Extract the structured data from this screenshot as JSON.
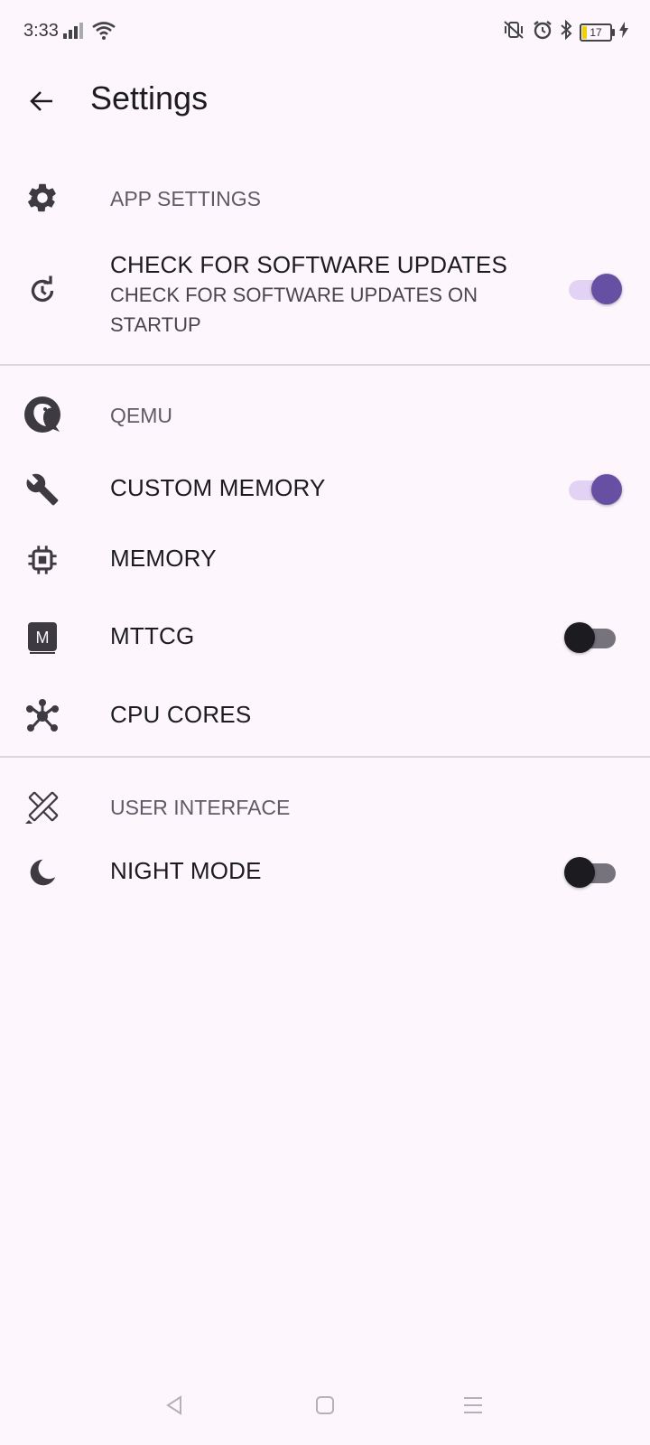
{
  "status_bar": {
    "time": "3:33",
    "battery_level": "17"
  },
  "app_bar": {
    "title": "Settings"
  },
  "sections": {
    "app_settings": {
      "category": "APP SETTINGS",
      "check_updates": {
        "title": "CHECK FOR SOFTWARE UPDATES",
        "summary": "CHECK FOR SOFTWARE UPDATES ON STARTUP",
        "enabled": true
      }
    },
    "qemu": {
      "category": "QEMU",
      "custom_memory": {
        "title": "CUSTOM MEMORY",
        "enabled": true
      },
      "memory": {
        "title": "MEMORY"
      },
      "mttcg": {
        "title": "MTTCG",
        "enabled": false,
        "icon_letter": "M"
      },
      "cpu_cores": {
        "title": "CPU CORES"
      }
    },
    "user_interface": {
      "category": "USER INTERFACE",
      "night_mode": {
        "title": "NIGHT MODE",
        "enabled": false
      }
    }
  },
  "colors": {
    "accent": "#6750a4",
    "background": "#fdf7fd"
  }
}
